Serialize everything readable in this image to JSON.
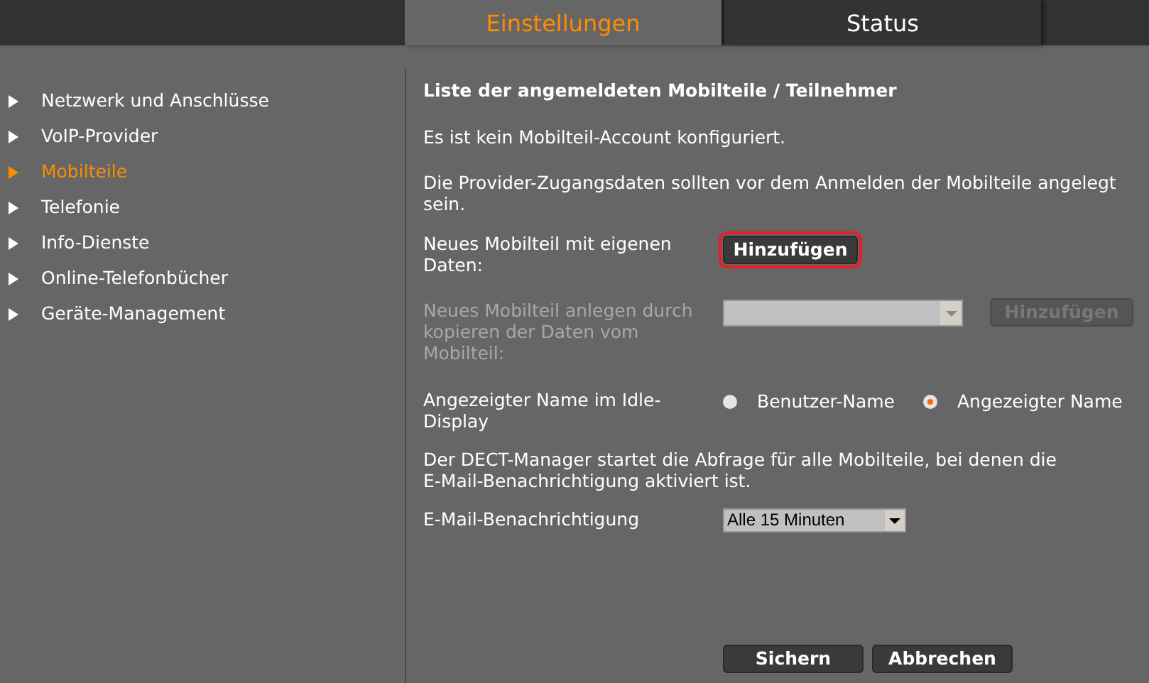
{
  "tabs": [
    {
      "label": "Einstellungen",
      "selected": true
    },
    {
      "label": "Status",
      "selected": false
    }
  ],
  "sidebar": {
    "items": [
      {
        "label": "Netzwerk und Anschlüsse",
        "selected": false
      },
      {
        "label": "VoIP-Provider",
        "selected": false
      },
      {
        "label": "Mobilteile",
        "selected": true
      },
      {
        "label": "Telefonie",
        "selected": false
      },
      {
        "label": "Info-Dienste",
        "selected": false
      },
      {
        "label": "Online-Telefonbücher",
        "selected": false
      },
      {
        "label": "Geräte-Management",
        "selected": false
      }
    ]
  },
  "content": {
    "title": "Liste der angemeldeten Mobilteile / Teilnehmer",
    "messages": [
      "Es ist kein Mobilteil-Account konfiguriert.",
      "Die Provider-Zugangsdaten sollten vor dem Anmelden der Mobilteile angelegt sein."
    ],
    "add_own": {
      "label": "Neues Mobilteil mit eigenen Daten:",
      "button": "Hinzufügen",
      "focused": true
    },
    "add_copy": {
      "label": "Neues Mobilteil anlegen durch kopieren der Daten vom Mobilteil:",
      "button": "Hinzufügen",
      "disabled": true
    },
    "display_name": {
      "label": "Angezeigter Name im Idle-Display",
      "options": [
        {
          "label": "Benutzer-Name",
          "selected": false
        },
        {
          "label": "Angezeigter Name",
          "selected": true
        }
      ]
    },
    "note": "Der DECT-Manager startet die Abfrage für alle Mobilteile, bei denen die E-Mail-Benachrichtigung aktiviert ist.",
    "email": {
      "label": "E-Mail-Benachrichtigung",
      "value": "Alle 15 Minuten"
    },
    "buttons": [
      "Sichern",
      "Abbrechen"
    ]
  }
}
